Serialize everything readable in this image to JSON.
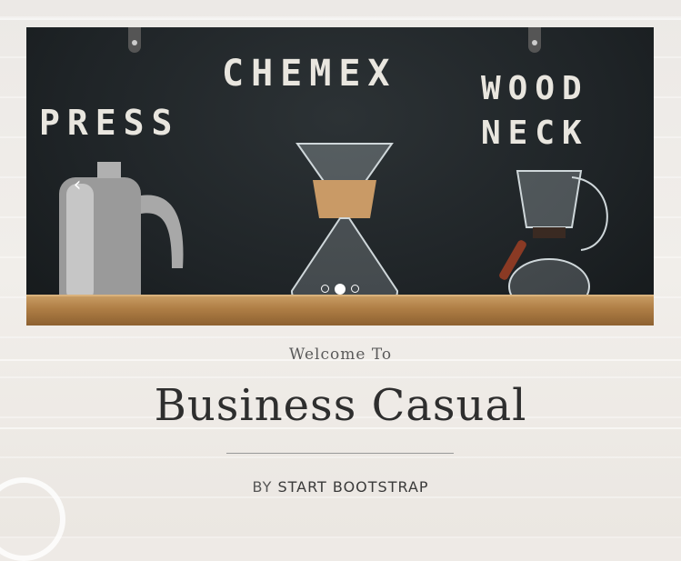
{
  "carousel": {
    "words": {
      "press": "PRESS",
      "chemex": "CHEMEX",
      "woodneck": "WOOD\nNECK"
    },
    "prev_icon": "chevron-left-icon",
    "indicators": [
      {
        "active": false
      },
      {
        "active": true
      },
      {
        "active": false
      }
    ]
  },
  "hero": {
    "welcome": "Welcome To",
    "title": "Business Casual",
    "by": "BY",
    "author": "START BOOTSTRAP"
  }
}
